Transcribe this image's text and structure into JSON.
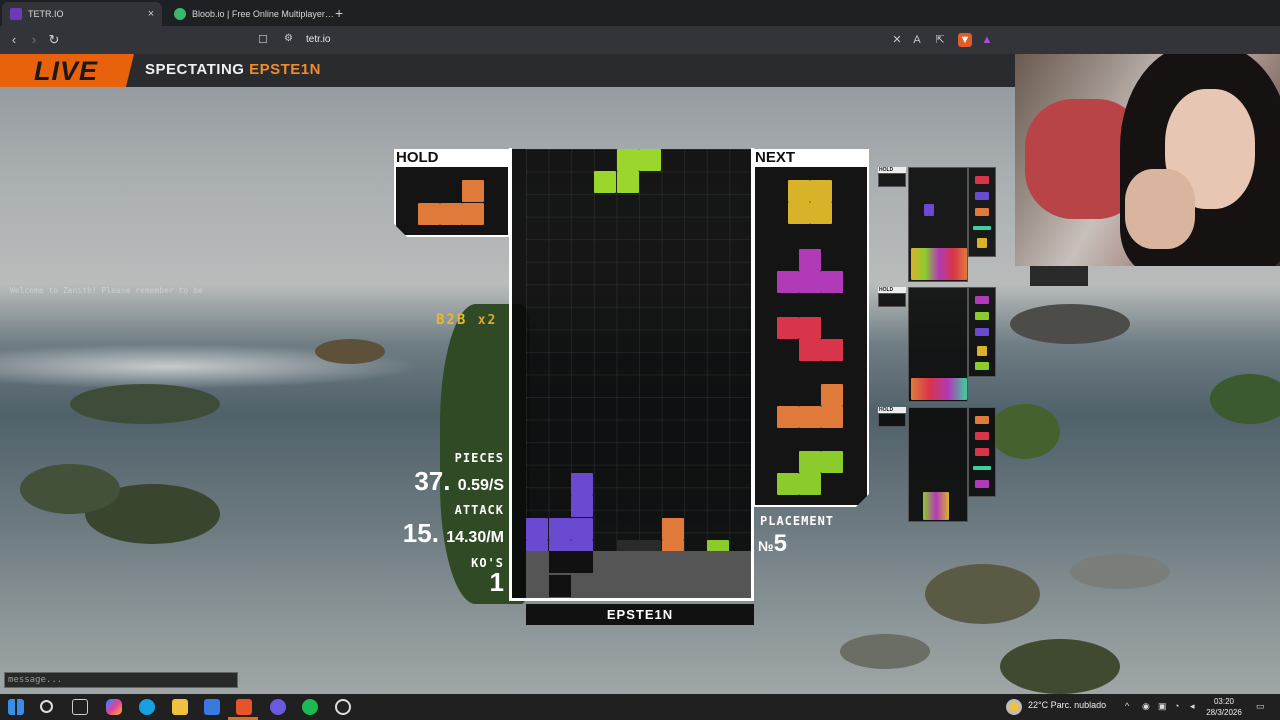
{
  "browser": {
    "tabs": [
      {
        "title": "TETR.IO",
        "close": "×",
        "active": true
      },
      {
        "title": "Bloob.io | Free Online Multiplayer Ga",
        "close": "",
        "active": false
      }
    ],
    "new_tab": "+",
    "url": "tetr.io",
    "nav": {
      "back": "‹",
      "forward": "›",
      "reload": "↻"
    }
  },
  "live_bar": {
    "badge": "LIVE",
    "spectating_prefix": "SPECTATING ",
    "spectating_name": "EPSTE1N"
  },
  "game": {
    "hold_label": "HOLD",
    "next_label": "NEXT",
    "b2b_label": "B2B",
    "b2b_mult": "x2",
    "pieces_label": "PIECES",
    "pieces_value": "37.",
    "pieces_rate": "0.59/S",
    "attack_label": "ATTACK",
    "attack_value": "15.",
    "attack_rate": "14.30/M",
    "kos_label": "KO'S",
    "kos_value": "1",
    "placement_label": "PLACEMENT",
    "placement_prefix": "№",
    "placement_value": "5",
    "player_name": "EPSTE1N",
    "hold_piece": "L",
    "next_queue": [
      "O",
      "T",
      "Z",
      "L",
      "S"
    ]
  },
  "chat": {
    "placeholder": "message...",
    "hint": "Welcome to Zenith! Please remember to be"
  },
  "taskbar": {
    "weather": "22°C  Parc. nublado",
    "time": "03:20",
    "date": "28/3/2026"
  },
  "colors": {
    "L": "#e07a3a",
    "O": "#d8b32a",
    "T": "#b13ab8",
    "Z": "#d8344a",
    "S": "#8ccb2c",
    "J": "#6a4ad0",
    "I": "#3ecf9c",
    "G": "#5a5a5a",
    "accent": "#e8620c"
  }
}
